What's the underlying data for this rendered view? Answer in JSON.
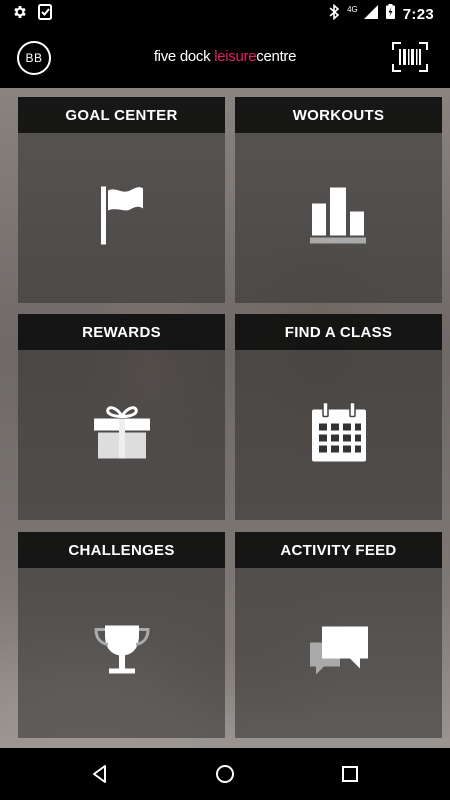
{
  "status_bar": {
    "time": "7:23",
    "network": "4G",
    "icons": [
      "settings-icon",
      "clipboard-check-icon",
      "bluetooth-icon",
      "signal-icon",
      "battery-charging-icon"
    ]
  },
  "header": {
    "avatar_initials": "BB",
    "brand_prefix": "five dock ",
    "brand_accent": "leisure",
    "brand_suffix": "centre",
    "accent_color": "#e0245e",
    "barcode_icon": "barcode-scan-icon"
  },
  "tiles": [
    {
      "label": "GOAL CENTER",
      "icon": "flag-icon"
    },
    {
      "label": "WORKOUTS",
      "icon": "bar-chart-icon"
    },
    {
      "label": "REWARDS",
      "icon": "gift-icon"
    },
    {
      "label": "FIND A CLASS",
      "icon": "calendar-icon"
    },
    {
      "label": "CHALLENGES",
      "icon": "trophy-icon"
    },
    {
      "label": "ACTIVITY FEED",
      "icon": "chat-bubbles-icon"
    }
  ],
  "nav_bar": {
    "icons": [
      "back-icon",
      "home-icon",
      "recents-icon"
    ]
  }
}
